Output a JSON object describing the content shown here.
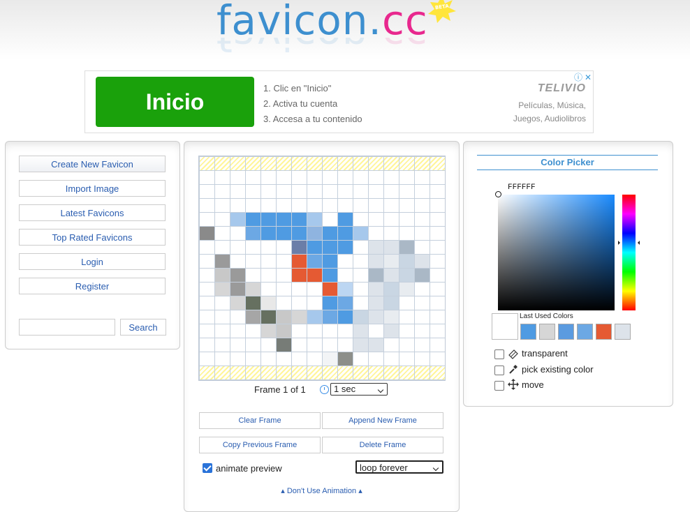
{
  "logo": {
    "part1": "favicon.",
    "part2": "cc",
    "badge": "BETA"
  },
  "ad": {
    "button": "Inicio",
    "steps": [
      "1. Clic en \"Inicio\"",
      "2. Activa tu cuenta",
      "3. Accesa a tu contenido"
    ],
    "brand": "TELIVIO",
    "desc_line1": "Películas, Música,",
    "desc_line2": "Juegos, Audiolibros"
  },
  "sidebar": {
    "items": [
      {
        "label": "Create New Favicon"
      },
      {
        "label": "Import Image"
      },
      {
        "label": "Latest Favicons"
      },
      {
        "label": "Top Rated Favicons"
      },
      {
        "label": "Login"
      },
      {
        "label": "Register"
      }
    ],
    "search": {
      "value": "",
      "button": "Search"
    }
  },
  "editor": {
    "frame_label": "Frame 1 of 1",
    "speed": "1 sec",
    "buttons": {
      "clear": "Clear Frame",
      "append": "Append New Frame",
      "copy": "Copy Previous Frame",
      "delete": "Delete Frame"
    },
    "animate_label": "animate preview",
    "animate_checked": true,
    "loop": "loop forever",
    "no_animation": "Don't Use Animation",
    "pixels": [
      [
        2,
        2,
        "#a6c8ec"
      ],
      [
        3,
        2,
        "#4f9be2"
      ],
      [
        4,
        2,
        "#4f9be2"
      ],
      [
        5,
        2,
        "#4f9be2"
      ],
      [
        6,
        2,
        "#4f9be2"
      ],
      [
        7,
        2,
        "#a6c8ec"
      ],
      [
        9,
        2,
        "#4f9be2"
      ],
      [
        0,
        3,
        "#8a8a8a"
      ],
      [
        3,
        3,
        "#6ca8e4"
      ],
      [
        4,
        3,
        "#4f9be2"
      ],
      [
        5,
        3,
        "#4f9be2"
      ],
      [
        6,
        3,
        "#4f9be2"
      ],
      [
        7,
        3,
        "#8fb4e0"
      ],
      [
        8,
        3,
        "#4f9be2"
      ],
      [
        9,
        3,
        "#4f9be2"
      ],
      [
        10,
        3,
        "#a6c8ec"
      ],
      [
        6,
        4,
        "#6b7ea8"
      ],
      [
        7,
        4,
        "#4f9be2"
      ],
      [
        8,
        4,
        "#4f9be2"
      ],
      [
        9,
        4,
        "#4f9be2"
      ],
      [
        11,
        4,
        "#dde3ea"
      ],
      [
        12,
        4,
        "#dde3ea"
      ],
      [
        13,
        4,
        "#aab8c6"
      ],
      [
        1,
        5,
        "#9a9a9a"
      ],
      [
        6,
        5,
        "#e55a33"
      ],
      [
        7,
        5,
        "#6ca8e4"
      ],
      [
        8,
        5,
        "#4f9be2"
      ],
      [
        11,
        5,
        "#dde3ea"
      ],
      [
        12,
        5,
        "#e8ecf0"
      ],
      [
        13,
        5,
        "#c9d6e3"
      ],
      [
        14,
        5,
        "#dde3ea"
      ],
      [
        1,
        6,
        "#c8c8c8"
      ],
      [
        2,
        6,
        "#9a9a9a"
      ],
      [
        6,
        6,
        "#e55a33"
      ],
      [
        7,
        6,
        "#e55a33"
      ],
      [
        8,
        6,
        "#4f9be2"
      ],
      [
        11,
        6,
        "#aab8c6"
      ],
      [
        12,
        6,
        "#dde3ea"
      ],
      [
        13,
        6,
        "#c9d6e3"
      ],
      [
        14,
        6,
        "#aab8c6"
      ],
      [
        1,
        7,
        "#d6d6d6"
      ],
      [
        2,
        7,
        "#9a9a9a"
      ],
      [
        3,
        7,
        "#d6d6d6"
      ],
      [
        8,
        7,
        "#e55a33"
      ],
      [
        9,
        7,
        "#bcd6f2"
      ],
      [
        11,
        7,
        "#dde3ea"
      ],
      [
        12,
        7,
        "#c9d6e3"
      ],
      [
        13,
        7,
        "#e8ecf0"
      ],
      [
        2,
        8,
        "#d6d6d6"
      ],
      [
        3,
        8,
        "#667060"
      ],
      [
        4,
        8,
        "#e8e8e8"
      ],
      [
        8,
        8,
        "#4f9be2"
      ],
      [
        9,
        8,
        "#6ca8e4"
      ],
      [
        11,
        8,
        "#dde3ea"
      ],
      [
        12,
        8,
        "#c9d6e3"
      ],
      [
        3,
        9,
        "#a6a6a6"
      ],
      [
        4,
        9,
        "#667060"
      ],
      [
        5,
        9,
        "#c8c8c8"
      ],
      [
        6,
        9,
        "#d6d6d6"
      ],
      [
        7,
        9,
        "#a6c8ec"
      ],
      [
        8,
        9,
        "#6ca8e4"
      ],
      [
        9,
        9,
        "#4f9be2"
      ],
      [
        10,
        9,
        "#c9d6e3"
      ],
      [
        11,
        9,
        "#dde3ea"
      ],
      [
        12,
        9,
        "#e8ecf0"
      ],
      [
        4,
        10,
        "#d6d6d6"
      ],
      [
        5,
        10,
        "#c8c8c8"
      ],
      [
        10,
        10,
        "#dde3ea"
      ],
      [
        12,
        10,
        "#dde3ea"
      ],
      [
        5,
        11,
        "#777c77"
      ],
      [
        10,
        11,
        "#dde3ea"
      ],
      [
        11,
        11,
        "#dde3ea"
      ],
      [
        8,
        12,
        "#f2f4f6"
      ],
      [
        9,
        12,
        "#8d8f8a"
      ]
    ]
  },
  "color_picker": {
    "title": "Color Picker",
    "hex": "FFFFFF",
    "last_used_label": "Last Used Colors",
    "last_used": [
      "#4f9be2",
      "#d6d6d6",
      "#5b9be0",
      "#6ca8e4",
      "#e55a33",
      "#dde3ea"
    ],
    "options": {
      "transparent": "transparent",
      "pick": "pick existing color",
      "move": "move"
    }
  }
}
